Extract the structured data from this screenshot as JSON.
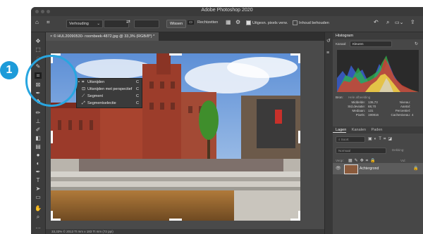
{
  "app": {
    "title": "Adobe Photoshop 2020"
  },
  "options_bar": {
    "ratio_dropdown": "Verhouding",
    "clear_button": "Wissen",
    "straighten_label": "Rechtzetten",
    "delete_pixels_label": "Uitgesn. pixels verw.",
    "content_aware_label": "Inhoud behouden"
  },
  "document": {
    "tab_title": "© HUL20090530- roombeek-4872.jpg @ 33,3% (RGB/8*) *",
    "status_text": "33,33%   © 2013 Tt mm x 183 Tt mm (72 ppi)"
  },
  "crop_flyout": {
    "items": [
      {
        "label": "Uitsnijden",
        "shortcut": "C",
        "icon": "crop-icon"
      },
      {
        "label": "Uitsnijden met perspectief",
        "shortcut": "C",
        "icon": "perspective-crop-icon"
      },
      {
        "label": "Segment",
        "shortcut": "C",
        "icon": "slice-icon"
      },
      {
        "label": "Segmentselectie",
        "shortcut": "C",
        "icon": "slice-select-icon"
      }
    ]
  },
  "callout": {
    "number": "1"
  },
  "histogram_panel": {
    "title": "Histogram",
    "channel_label": "Kanaal:",
    "channel_value": "Kleuren",
    "source_label": "Bron:",
    "source_value": "Hele afbeelding",
    "stats": {
      "gemiddelde_label": "Middelde:",
      "gemiddelde_value": "136,73",
      "std_label": "Std.deviatie:",
      "std_value": "68,70",
      "median_label": "Mediaan:",
      "median_value": "131",
      "pixels_label": "Pixels:",
      "pixels_value": "190816",
      "niveau_label": "Niveau:",
      "niveau_value": "",
      "aantal_label": "Aantal:",
      "aantal_value": "",
      "percentiel_label": "Percentiel:",
      "percentiel_value": "",
      "cache_label": "Cacheniveau:",
      "cache_value": "4"
    }
  },
  "layers_panel": {
    "tabs": [
      "Lagen",
      "Kanalen",
      "Paden"
    ],
    "search_placeholder": "Soort",
    "blend_mode": "Normaal",
    "opacity_label": "Dekking:",
    "lock_label": "Vergr:",
    "fill_label": "Vul:",
    "layer_name": "Achtergrond"
  },
  "colors": {
    "accent_blue": "#29a6e0",
    "badge_blue": "#1d9bd9",
    "panel_bg": "#474747"
  }
}
